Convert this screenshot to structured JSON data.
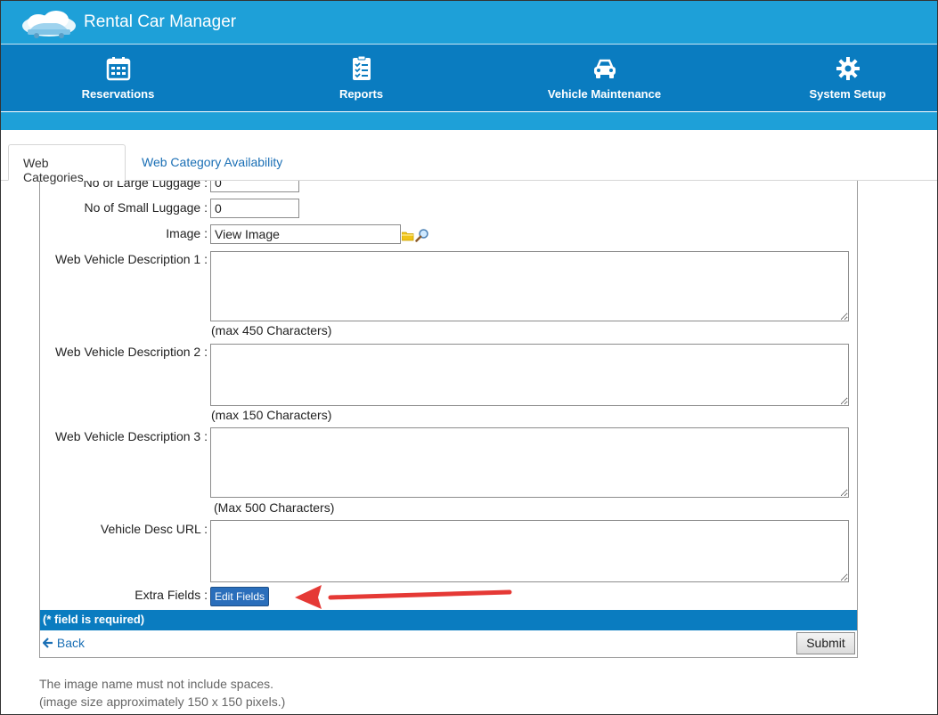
{
  "app": {
    "title": "Rental Car Manager"
  },
  "nav": [
    {
      "label": "Reservations",
      "icon": "calendar-icon"
    },
    {
      "label": "Reports",
      "icon": "checklist-icon"
    },
    {
      "label": "Vehicle Maintenance",
      "icon": "car-icon"
    },
    {
      "label": "System Setup",
      "icon": "gear-icon"
    }
  ],
  "tabs": [
    {
      "label": "Web Categories",
      "active": true
    },
    {
      "label": "Web Category Availability",
      "active": false
    }
  ],
  "form": {
    "large_luggage": {
      "label": "No of Large Luggage :",
      "value": "0"
    },
    "small_luggage": {
      "label": "No of Small Luggage :",
      "value": "0"
    },
    "image": {
      "label": "Image :",
      "value": "View Image"
    },
    "desc1": {
      "label": "Web Vehicle Description 1 :",
      "hint": "(max 450 Characters)"
    },
    "desc2": {
      "label": "Web Vehicle Description 2 :",
      "hint": "(max 150 Characters)"
    },
    "desc3": {
      "label": "Web Vehicle Description 3 :",
      "hint": "(Max 500 Characters)"
    },
    "desc_url": {
      "label": "Vehicle Desc URL :"
    },
    "extra_fields": {
      "label": "Extra Fields :",
      "button": "Edit Fields"
    },
    "required_note": "(* field is required)",
    "back": "Back",
    "submit": "Submit"
  },
  "footnotes": [
    "The image name must not include spaces.",
    "(image size approximately 150 x 150 pixels.)"
  ],
  "colors": {
    "top_bar": "#1ea0d8",
    "nav_bar": "#0a7cc0",
    "annotation_arrow": "#e53935"
  }
}
